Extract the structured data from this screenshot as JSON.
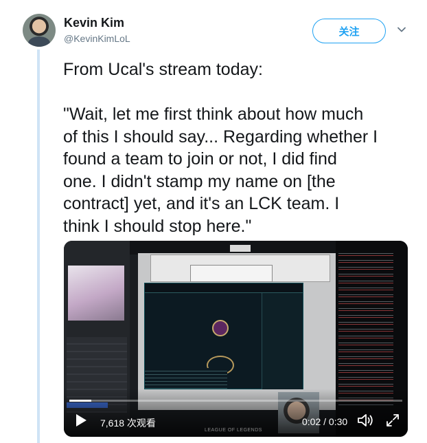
{
  "user": {
    "name": "Kevin Kim",
    "handle": "@KevinKimLoL"
  },
  "follow": {
    "label": "关注"
  },
  "tweet": {
    "lines": [
      "From Ucal's stream today:",
      "",
      "\"Wait, let me first think about how much",
      "of this I should say... Regarding whether I",
      "found a team to join or not, I did find",
      "one. I didn't stamp my name on [the",
      "contract] yet, and it's an LCK team. I",
      "think I should stop here.\""
    ]
  },
  "video": {
    "view_count": "7,618 次观看",
    "time": "0:02 / 0:30",
    "progress_fraction": 0.067,
    "watermark": "LEAGUE OF LEGENDS"
  },
  "icons": {
    "play": "play-icon",
    "volume": "volume-icon",
    "fullscreen": "fullscreen-icon",
    "caret": "chevron-down-icon"
  },
  "colors": {
    "accent": "#1da1f2",
    "thread_line": "#cfe3f5",
    "handle": "#657786"
  }
}
